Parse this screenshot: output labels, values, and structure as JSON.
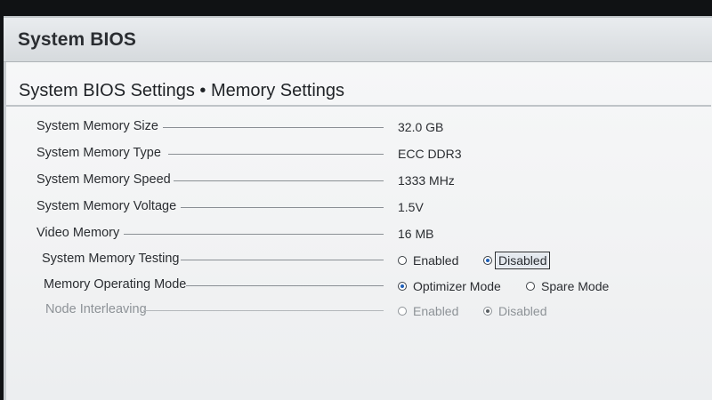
{
  "window": {
    "title": "System BIOS"
  },
  "page": {
    "heading": "System BIOS Settings • Memory Settings"
  },
  "settings": [
    {
      "label": "System Memory Size",
      "value": "32.0 GB"
    },
    {
      "label": "System Memory Type",
      "value": "ECC DDR3"
    },
    {
      "label": "System Memory Speed",
      "value": "1333 MHz"
    },
    {
      "label": "System Memory Voltage",
      "value": "1.5V"
    },
    {
      "label": "Video Memory",
      "value": "16 MB"
    }
  ],
  "memory_testing": {
    "label": "System Memory Testing",
    "options": [
      "Enabled",
      "Disabled"
    ],
    "selected": "Disabled"
  },
  "operating_mode": {
    "label": "Memory Operating Mode",
    "options": [
      "Optimizer Mode",
      "Spare Mode"
    ],
    "selected": "Optimizer Mode"
  },
  "node_interleaving": {
    "label": "Node Interleaving",
    "options": [
      "Enabled",
      "Disabled"
    ],
    "selected": "Disabled",
    "state": "disabled"
  },
  "colors": {
    "selected_dot": "#1d5fb8",
    "panel_bg": "#f3f4f5",
    "titlebar_bg": "#dfe3e6"
  }
}
